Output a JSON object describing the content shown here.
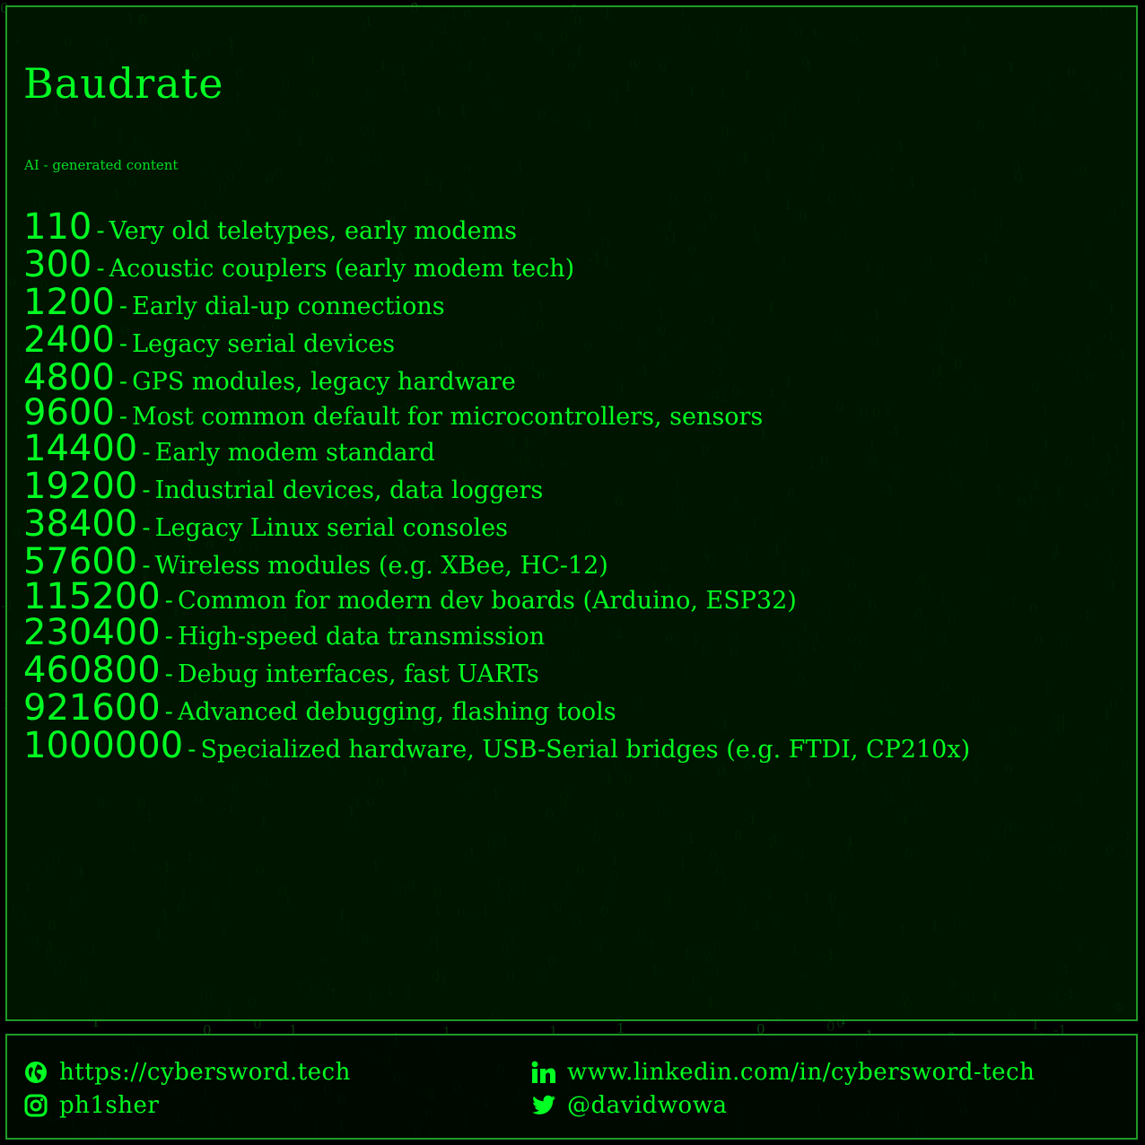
{
  "header": {
    "title": "Baudrate",
    "note": "AI - generated content"
  },
  "rates": [
    {
      "value": "110",
      "separator": "-",
      "description": "Very old teletypes, early modems"
    },
    {
      "value": "300",
      "separator": "-",
      "description": "Acoustic couplers (early modem tech)"
    },
    {
      "value": "1200",
      "separator": "-",
      "description": "Early dial-up connections"
    },
    {
      "value": "2400",
      "separator": "-",
      "description": "Legacy serial devices"
    },
    {
      "value": "4800",
      "separator": "-",
      "description": "GPS modules, legacy hardware"
    },
    {
      "value": "9600",
      "separator": "-",
      "description": "Most common default for microcontrollers, sensors"
    },
    {
      "value": "14400",
      "separator": "-",
      "description": "Early modem standard"
    },
    {
      "value": "19200",
      "separator": "-",
      "description": "Industrial devices, data loggers"
    },
    {
      "value": "38400",
      "separator": "-",
      "description": "Legacy Linux serial consoles"
    },
    {
      "value": "57600",
      "separator": "-",
      "description": "Wireless modules (e.g. XBee, HC-12)"
    },
    {
      "value": "115200",
      "separator": "-",
      "description": "Common for modern dev boards (Arduino, ESP32)"
    },
    {
      "value": "230400",
      "separator": "-",
      "description": "High-speed data transmission"
    },
    {
      "value": "460800",
      "separator": "-",
      "description": "Debug interfaces, fast UARTs"
    },
    {
      "value": "921600",
      "separator": "-",
      "description": "Advanced debugging, flashing tools"
    },
    {
      "value": "1000000",
      "separator": "-",
      "description": "Specialized hardware, USB-Serial bridges (e.g. FTDI, CP210x)"
    }
  ],
  "footer": {
    "website": {
      "icon": "globe-icon",
      "text": "https://cybersword.tech"
    },
    "instagram": {
      "icon": "instagram-icon",
      "text": "ph1sher"
    },
    "linkedin": {
      "icon": "linkedin-icon",
      "text": "www.linkedin.com/in/cybersword-tech"
    },
    "twitter": {
      "icon": "twitter-icon",
      "text": "@davidwowa"
    }
  },
  "colors": {
    "accent": "#00ff22",
    "border": "#1f9a26",
    "background": "#000000",
    "panel": "#001800",
    "background_digits": "#0a5a12"
  }
}
